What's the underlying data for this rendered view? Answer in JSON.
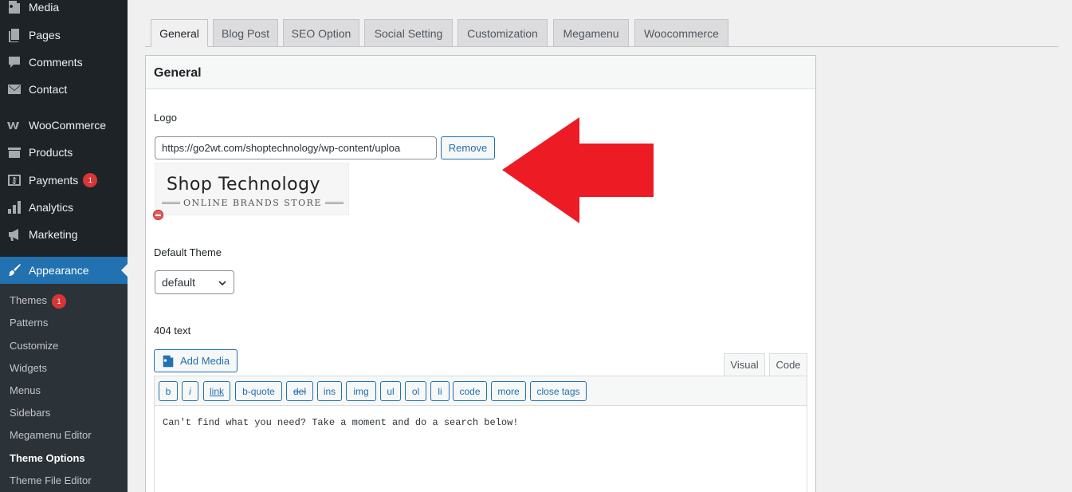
{
  "sidebar": {
    "items": [
      {
        "label": "Media",
        "icon": "media-icon"
      },
      {
        "label": "Pages",
        "icon": "pages-icon"
      },
      {
        "label": "Comments",
        "icon": "comments-icon"
      },
      {
        "label": "Contact",
        "icon": "mail-icon"
      },
      {
        "label": "WooCommerce",
        "icon": "woocommerce-icon"
      },
      {
        "label": "Products",
        "icon": "products-icon"
      },
      {
        "label": "Payments",
        "icon": "payments-icon",
        "badge": "1"
      },
      {
        "label": "Analytics",
        "icon": "analytics-icon"
      },
      {
        "label": "Marketing",
        "icon": "megaphone-icon"
      },
      {
        "label": "Appearance",
        "icon": "paintbrush-icon",
        "active": true
      }
    ],
    "submenu": [
      {
        "label": "Themes",
        "badge": "1"
      },
      {
        "label": "Patterns"
      },
      {
        "label": "Customize"
      },
      {
        "label": "Widgets"
      },
      {
        "label": "Menus"
      },
      {
        "label": "Sidebars"
      },
      {
        "label": "Megamenu Editor"
      },
      {
        "label": "Theme Options",
        "current": true
      },
      {
        "label": "Theme File Editor"
      }
    ]
  },
  "tabs": [
    "General",
    "Blog Post",
    "SEO Option",
    "Social Setting",
    "Customization",
    "Megamenu",
    "Woocommerce"
  ],
  "active_tab": "General",
  "panel": {
    "title": "General",
    "logo": {
      "label": "Logo",
      "value": "https://go2wt.com/shoptechnology/wp-content/uploa",
      "remove_label": "Remove",
      "preview_title": "Shop Technology",
      "preview_subtitle": "ONLINE BRANDS STORE"
    },
    "default_theme": {
      "label": "Default Theme",
      "selected": "default"
    },
    "text_404": {
      "label": "404 text",
      "add_media_label": "Add Media",
      "visual_tab": "Visual",
      "code_tab": "Code",
      "quicktags": [
        "b",
        "i",
        "link",
        "b-quote",
        "del",
        "ins",
        "img",
        "ul",
        "ol",
        "li",
        "code",
        "more",
        "close tags"
      ],
      "content": "Can't find what you need? Take a moment and do a search below!"
    }
  },
  "colors": {
    "sidebar_bg": "#1d2327",
    "accent": "#2271b1",
    "badge": "#d63638",
    "arrow": "#ed1c24"
  }
}
